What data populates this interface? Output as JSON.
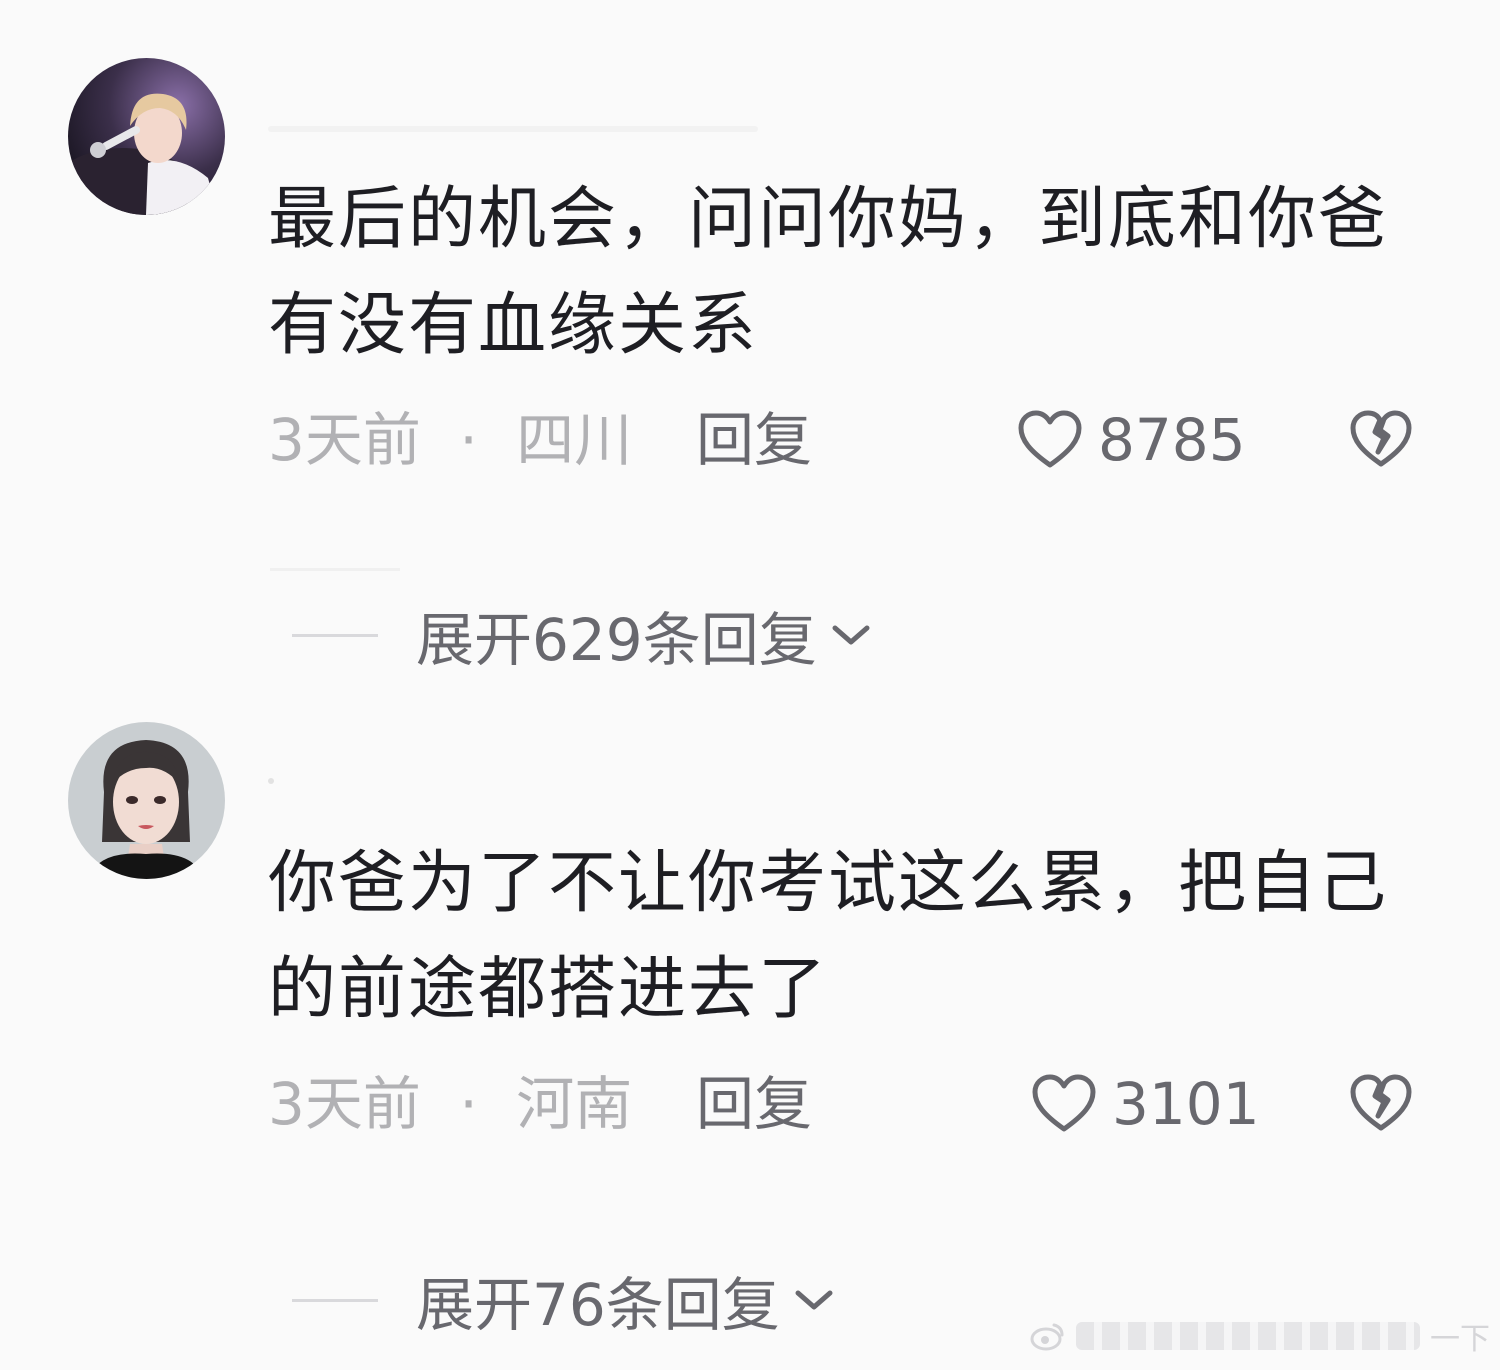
{
  "comments": [
    {
      "text": "最后的机会，问问你妈，到底和你爸有没有血缘关系",
      "time": "3天前",
      "location": "四川",
      "reply_label": "回复",
      "likes": "8785",
      "expand_label": "展开629条回复"
    },
    {
      "text": "你爸为了不让你考试这么累，把自己的前途都搭进去了",
      "time": "3天前",
      "location": "河南",
      "reply_label": "回复",
      "likes": "3101",
      "expand_label": "展开76条回复"
    }
  ],
  "separator": "·",
  "watermark_tail": "一下",
  "colors": {
    "text_primary": "#1e1e23",
    "text_meta": "#b1b1b4",
    "text_action": "#68686e",
    "background": "#fafafa"
  },
  "icons": {
    "like": "heart-outline-icon",
    "dislike": "broken-heart-icon",
    "expand": "chevron-down-icon"
  }
}
